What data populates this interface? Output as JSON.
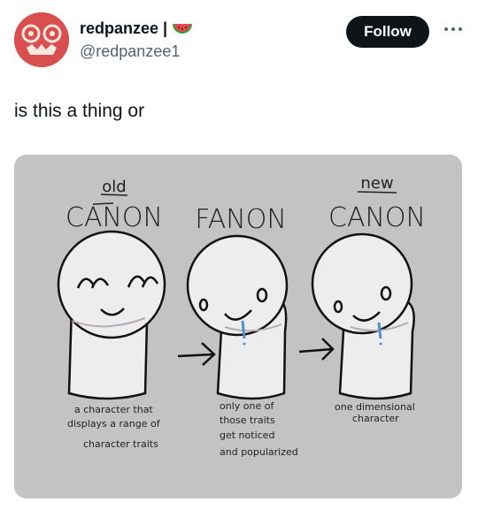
{
  "author": {
    "display_name": "redpanzee |",
    "emoji_icon": "watermelon-icon",
    "handle": "@redpanzee1",
    "avatar_color": "#d94e4e"
  },
  "actions": {
    "follow_label": "Follow",
    "more_icon": "more-horizontal-icon"
  },
  "tweet": {
    "text": "is this a thing or"
  },
  "image": {
    "background": "#c3c3c3",
    "headers": {
      "old_small": "old",
      "canon_left": "CANON",
      "fanon": "FANON",
      "new_small": "new",
      "canon_right": "CANON"
    },
    "captions": {
      "left": [
        "a character that",
        "displays a range of",
        "character traits"
      ],
      "middle": [
        "only one of",
        "those traits",
        "get noticed",
        "and popularized"
      ],
      "right": [
        "one dimensional",
        "character"
      ]
    }
  }
}
